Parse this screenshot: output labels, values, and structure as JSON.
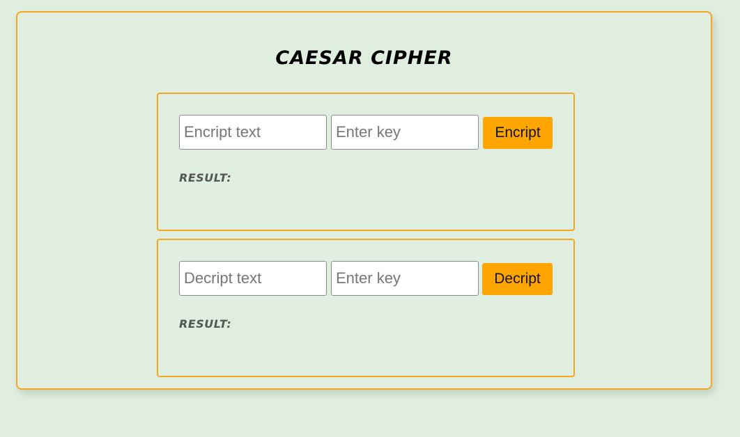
{
  "app": {
    "title": "CAESAR CIPHER"
  },
  "encrypt": {
    "text_placeholder": "Encript text",
    "key_placeholder": "Enter key",
    "button_label": "Encript",
    "result_label": "RESULT:",
    "result_value": ""
  },
  "decrypt": {
    "text_placeholder": "Decript text",
    "key_placeholder": "Enter key",
    "button_label": "Decript",
    "result_label": "RESULT:",
    "result_value": ""
  },
  "colors": {
    "background": "#dfeedf",
    "accent": "#ffa500",
    "border": "#f5a623"
  }
}
